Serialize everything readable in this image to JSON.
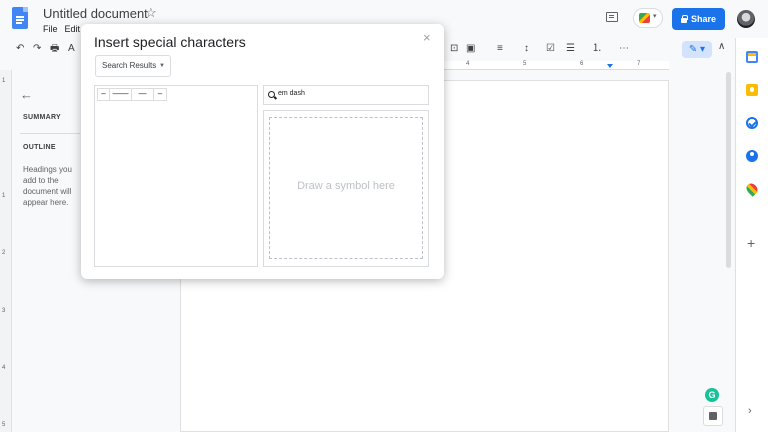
{
  "header": {
    "doc_title": "Untitled document",
    "menus": [
      "File",
      "Edit"
    ],
    "share_label": "Share"
  },
  "toolbar": {
    "undo": "↶",
    "redo": "↷",
    "print": "🖶",
    "spellcheck": "A",
    "comment": "⊡",
    "image": "▣",
    "align": "≡",
    "line_spacing": "↕",
    "checklist": "☑",
    "bullets": "☰",
    "numbered": "⒈",
    "more": "⋯",
    "edit_mode": "✎",
    "collapse": "∧"
  },
  "ruler": {
    "labels": [
      "4",
      "5",
      "6",
      "7"
    ]
  },
  "vruler": {
    "labels": [
      "1",
      "1",
      "2",
      "3",
      "4",
      "5"
    ]
  },
  "outline": {
    "summary": "SUMMARY",
    "outline": "OUTLINE",
    "hint": "Headings you add to the document will appear here."
  },
  "dialog": {
    "title": "Insert special characters",
    "close": "×",
    "category": "Search Results",
    "results": [
      "–",
      "——",
      "—",
      "–"
    ],
    "search_value": "em dash",
    "draw_placeholder": "Draw a symbol here"
  },
  "sidepanel": {
    "add": "+",
    "expand": "›"
  },
  "grammarly": "G",
  "colors": {
    "accent": "#1a73e8",
    "dialog_bg": "#ffffff"
  }
}
